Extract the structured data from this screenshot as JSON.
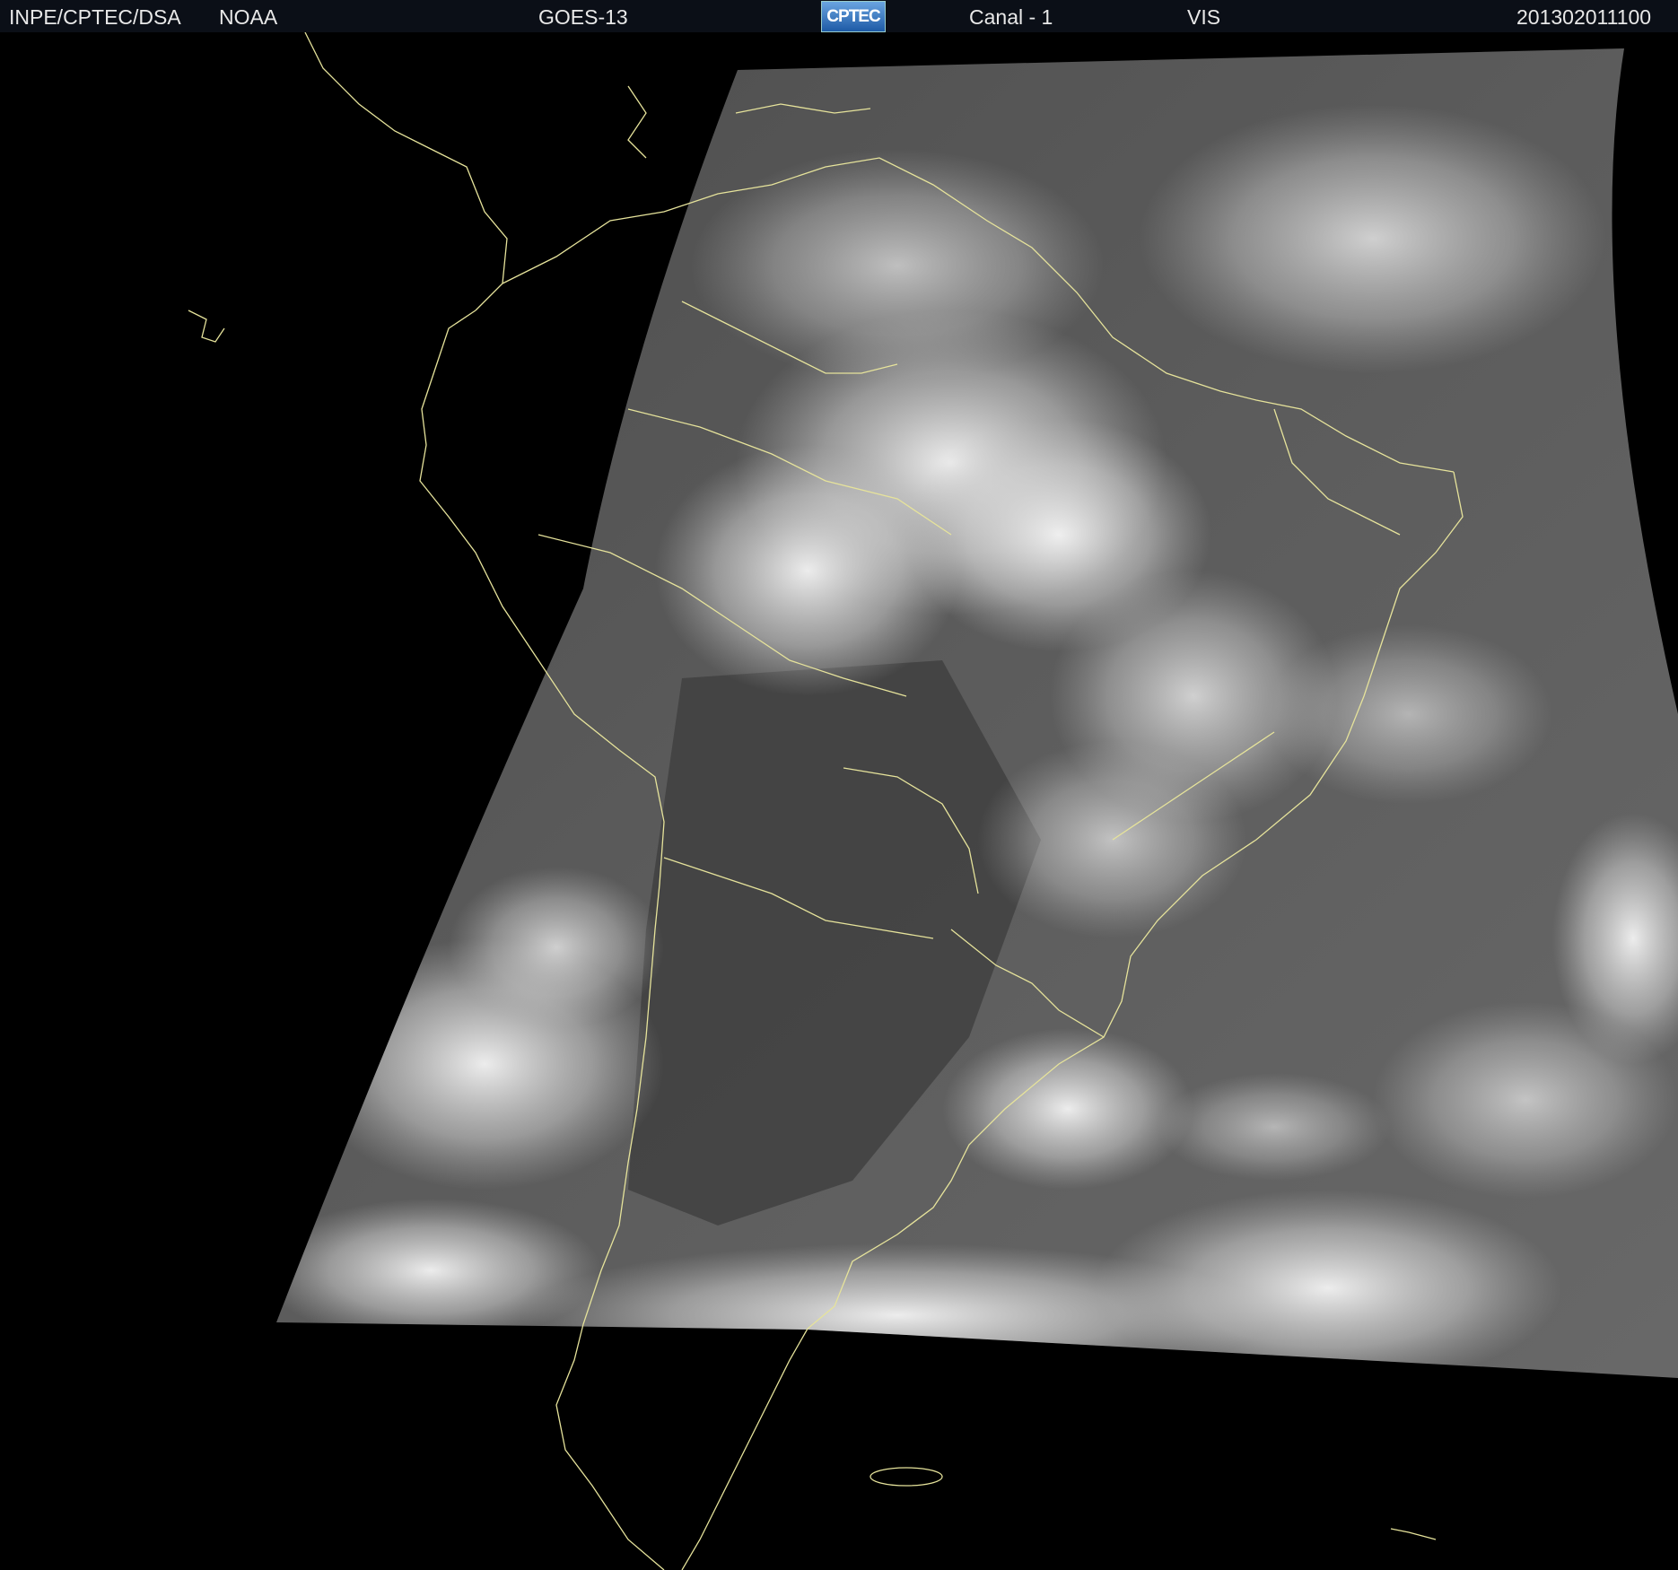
{
  "header": {
    "agency": "INPE/CPTEC/DSA",
    "partner": "NOAA",
    "satellite": "GOES-13",
    "logo_text": "CPTEC",
    "channel": "Canal - 1",
    "band": "VIS",
    "timestamp": "201302011100"
  },
  "map": {
    "product": "visible satellite imagery",
    "region": "South America",
    "coastline_color": "#e6e39b",
    "background_color": "#000000"
  }
}
